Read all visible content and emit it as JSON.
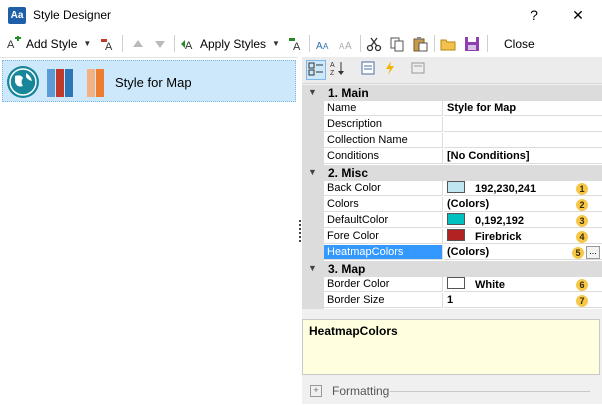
{
  "window": {
    "title": "Style Designer",
    "icon_text": "Aa",
    "help": "?",
    "close": "✕"
  },
  "toolbar": {
    "add_style": "Add Style",
    "apply_styles": "Apply Styles",
    "close": "Close",
    "icons": [
      "add-style-icon",
      "edit-style-icon",
      "move-up-icon",
      "move-down-icon",
      "apply-styles-icon",
      "style-settings-icon",
      "font-small-icon",
      "font-large-icon",
      "cut-icon",
      "copy-icon",
      "paste-icon",
      "open-icon",
      "save-icon"
    ]
  },
  "styles_list": {
    "items": [
      {
        "name": "Style for Map",
        "colors": [
          "#5b9bd5",
          "#c0392b",
          "#2e75b6",
          "#f4b183",
          "#ed7d31"
        ]
      }
    ]
  },
  "property_grid": {
    "categories": [
      {
        "label": "1. Main",
        "props": [
          {
            "name": "Name",
            "value": "Style for Map"
          },
          {
            "name": "Description",
            "value": ""
          },
          {
            "name": "Collection Name",
            "value": ""
          },
          {
            "name": "Conditions",
            "value": "[No Conditions]"
          }
        ]
      },
      {
        "label": "2. Misc",
        "props": [
          {
            "name": "Back Color",
            "value": "192,230,241",
            "swatch": "#c0e6f1",
            "badge": "1"
          },
          {
            "name": "Colors",
            "value": "(Colors)",
            "badge": "2"
          },
          {
            "name": "DefaultColor",
            "value": "0,192,192",
            "swatch": "#00c0c0",
            "badge": "3"
          },
          {
            "name": "Fore Color",
            "value": "Firebrick",
            "swatch": "#b22222",
            "badge": "4"
          },
          {
            "name": "HeatmapColors",
            "value": "(Colors)",
            "badge": "5",
            "selected": true,
            "ellipsis": "..."
          }
        ]
      },
      {
        "label": "3. Map",
        "props": [
          {
            "name": "Border Color",
            "value": "White",
            "swatch": "#ffffff",
            "badge": "6"
          },
          {
            "name": "Border Size",
            "value": "1",
            "badge": "7"
          }
        ]
      }
    ]
  },
  "description": {
    "title": "HeatmapColors"
  },
  "formatting": {
    "label": "Formatting",
    "toggle": "+"
  }
}
